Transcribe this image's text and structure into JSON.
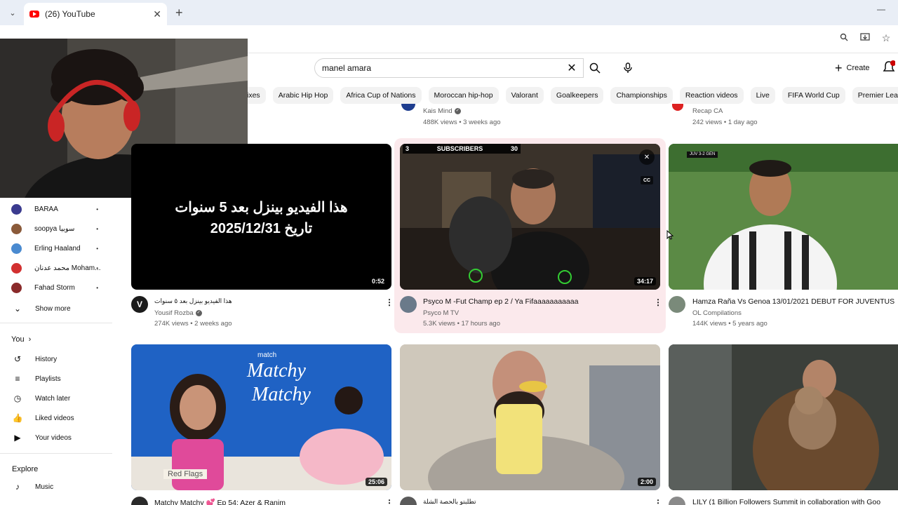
{
  "browser": {
    "tab_title": "(26) YouTube",
    "new_tab_symbol": "+"
  },
  "search": {
    "query": "manel amara"
  },
  "header": {
    "create_label": "Create"
  },
  "chips": [
    "ixes",
    "Arabic Hip Hop",
    "Africa Cup of Nations",
    "Moroccan hip-hop",
    "Valorant",
    "Goalkeepers",
    "Championships",
    "Reaction videos",
    "Live",
    "FIFA World Cup",
    "Premier League"
  ],
  "row_above": {
    "col2_channel": "Kais Mind",
    "col2_meta": "488K views • 3 weeks ago",
    "col3_channel": "Recap CA",
    "col3_meta": "242 views • 1 day ago"
  },
  "sidebar": {
    "subscriptions": [
      {
        "name": "BARAA",
        "color": "#3b3b8f"
      },
      {
        "name": "soopya سوبيا",
        "color": "#8a5a3a"
      },
      {
        "name": "Erling Haaland",
        "color": "#4a8ad0"
      },
      {
        "name": "محمد عدنان Moham...",
        "color": "#d23030"
      },
      {
        "name": "Fahad Storm",
        "color": "#8a2a2a"
      }
    ],
    "show_more": "Show more",
    "you_label": "You",
    "you_items": [
      "History",
      "Playlists",
      "Watch later",
      "Liked videos",
      "Your videos"
    ],
    "explore_label": "Explore",
    "explore_items": [
      "Music"
    ]
  },
  "videos": [
    {
      "thumb_text_line1": "هذا الفيديو بينزل بعد 5 سنوات",
      "thumb_text_line2": "تاريخ 2025/12/31",
      "duration": "0:52",
      "title": "هذا الفيديو بينزل بعد ٥ سنوات",
      "channel": "Yousif Rozba",
      "meta": "274K views • 2 weeks ago"
    },
    {
      "overlay_label": "SUBSCRIBERS",
      "overlay_count": "30",
      "overlay_left": "3",
      "duration": "34:17",
      "title": "Psyco M -Fut Champ ep 2  / Ya Fifaaaaaaaaaaa",
      "channel": "Psyco M TV",
      "meta": "5.3K views • 17 hours ago",
      "cc_label": "CC"
    },
    {
      "score": "JUV  3-2  GEN",
      "title": "Hamza Raña  Vs   Genoa  13/01/2021  DEBUT FOR JUVENTUS",
      "channel": "OL Compilations",
      "meta": "144K views • 5 years ago"
    },
    {
      "brand": "match",
      "show_title_1": "Matchy",
      "show_title_2": "Matchy",
      "tag": "Red Flags",
      "duration": "25:06",
      "title": "Matchy Matchy 💕 Ep 54: Azer & Ranim"
    },
    {
      "duration": "2:00",
      "title": "تطلبتو بالحصة الشلة"
    },
    {
      "title": "LILY (1 Billion Followers Summit in collaboration with Goo"
    }
  ]
}
